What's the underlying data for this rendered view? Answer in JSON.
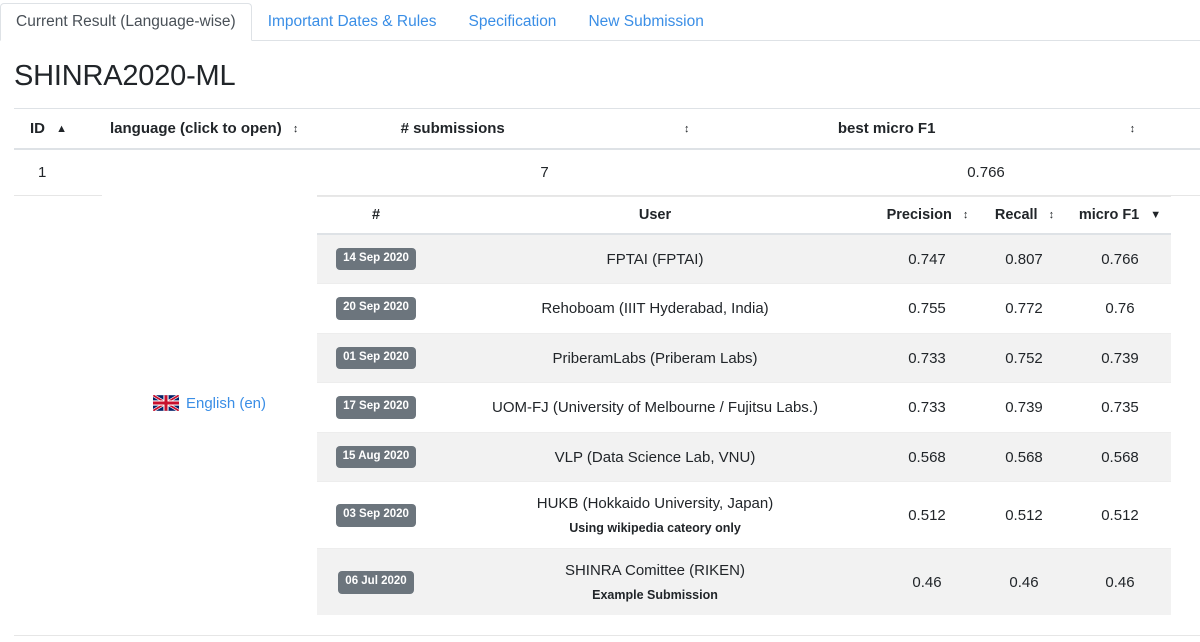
{
  "tabs": [
    {
      "label": "Current Result (Language-wise)",
      "active": true
    },
    {
      "label": "Important Dates & Rules",
      "active": false
    },
    {
      "label": "Specification",
      "active": false
    },
    {
      "label": "New Submission",
      "active": false
    }
  ],
  "page": {
    "title": "SHINRA2020-ML"
  },
  "outer_table": {
    "headers": {
      "id": "ID",
      "language": "language (click to open)",
      "submissions": "# submissions",
      "best_micro_f1": "best micro F1"
    },
    "sort": {
      "id": "ascending",
      "language": "sortable",
      "submissions": "sortable",
      "best_micro_f1": "sortable"
    },
    "row": {
      "id": "1",
      "language_label": "English (en)",
      "language_flag": "uk-flag-icon",
      "submissions": "7",
      "best_micro_f1": "0.766"
    }
  },
  "inner_table": {
    "headers": {
      "num": "#",
      "user": "User",
      "precision": "Precision",
      "recall": "Recall",
      "micro_f1": "micro F1"
    },
    "sort": {
      "precision": "sortable",
      "recall": "sortable",
      "micro_f1": "descending"
    },
    "rows": [
      {
        "date": "14 Sep 2020",
        "user": "FPTAI (FPTAI)",
        "note": "",
        "precision": "0.747",
        "recall": "0.807",
        "micro_f1": "0.766"
      },
      {
        "date": "20 Sep 2020",
        "user": "Rehoboam (IIIT Hyderabad, India)",
        "note": "",
        "precision": "0.755",
        "recall": "0.772",
        "micro_f1": "0.76"
      },
      {
        "date": "01 Sep 2020",
        "user": "PriberamLabs (Priberam Labs)",
        "note": "",
        "precision": "0.733",
        "recall": "0.752",
        "micro_f1": "0.739"
      },
      {
        "date": "17 Sep 2020",
        "user": "UOM-FJ (University of Melbourne / Fujitsu Labs.)",
        "note": "",
        "precision": "0.733",
        "recall": "0.739",
        "micro_f1": "0.735"
      },
      {
        "date": "15 Aug 2020",
        "user": "VLP (Data Science Lab, VNU)",
        "note": "",
        "precision": "0.568",
        "recall": "0.568",
        "micro_f1": "0.568"
      },
      {
        "date": "03 Sep 2020",
        "user": "HUKB (Hokkaido University, Japan)",
        "note": "Using wikipedia cateory only",
        "precision": "0.512",
        "recall": "0.512",
        "micro_f1": "0.512"
      },
      {
        "date": "06 Jul 2020",
        "user": "SHINRA Comittee (RIKEN)",
        "note": "Example Submission",
        "precision": "0.46",
        "recall": "0.46",
        "micro_f1": "0.46"
      }
    ]
  },
  "colors": {
    "link": "#3a8ee6",
    "badge_bg": "#6c757d",
    "row_alt_bg": "#f2f2f2",
    "border": "#dee2e6",
    "text": "#212529"
  }
}
